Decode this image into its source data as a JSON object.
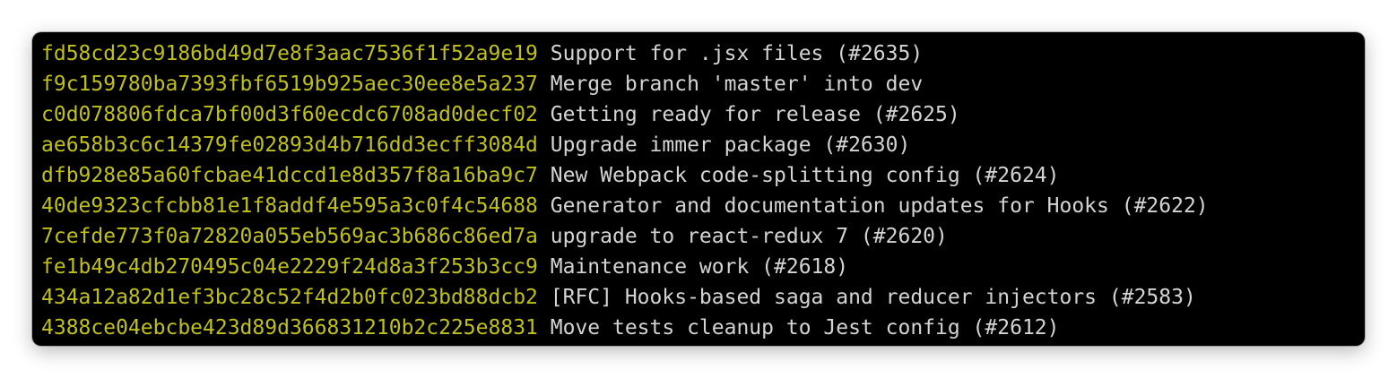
{
  "colors": {
    "hash": "#c0c01a",
    "message": "#d4d4d4",
    "background": "#000000"
  },
  "commits": [
    {
      "hash": "fd58cd23c9186bd49d7e8f3aac7536f1f52a9e19",
      "message": "Support for .jsx files (#2635)"
    },
    {
      "hash": "f9c159780ba7393fbf6519b925aec30ee8e5a237",
      "message": "Merge branch 'master' into dev"
    },
    {
      "hash": "c0d078806fdca7bf00d3f60ecdc6708ad0decf02",
      "message": "Getting ready for release (#2625)"
    },
    {
      "hash": "ae658b3c6c14379fe02893d4b716dd3ecff3084d",
      "message": "Upgrade immer package (#2630)"
    },
    {
      "hash": "dfb928e85a60fcbae41dccd1e8d357f8a16ba9c7",
      "message": "New Webpack code-splitting config (#2624)"
    },
    {
      "hash": "40de9323cfcbb81e1f8addf4e595a3c0f4c54688",
      "message": "Generator and documentation updates for Hooks (#2622)"
    },
    {
      "hash": "7cefde773f0a72820a055eb569ac3b686c86ed7a",
      "message": "upgrade to react-redux 7 (#2620)"
    },
    {
      "hash": "fe1b49c4db270495c04e2229f24d8a3f253b3cc9",
      "message": "Maintenance work (#2618)"
    },
    {
      "hash": "434a12a82d1ef3bc28c52f4d2b0fc023bd88dcb2",
      "message": "[RFC] Hooks-based saga and reducer injectors (#2583)"
    },
    {
      "hash": "4388ce04ebcbe423d89d366831210b2c225e8831",
      "message": "Move tests cleanup to Jest config (#2612)"
    }
  ]
}
